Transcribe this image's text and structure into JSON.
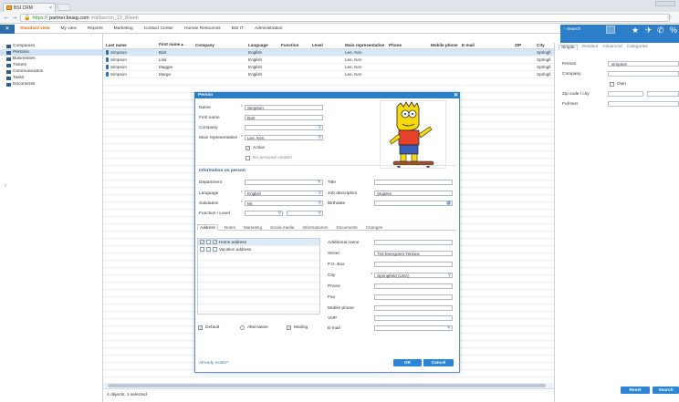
{
  "browser": {
    "tab_title": "BSI CRM",
    "url_scheme": "https://",
    "url_host": "partner.bsiag.com",
    "url_path": "/int/bsicrm_12_8/web"
  },
  "app": {
    "menu": [
      "Standard view",
      "My view",
      "Reports",
      "Marketing",
      "Contact Center",
      "Human Resources",
      "BSI IT",
      "Administration"
    ],
    "active_menu": "Standard view"
  },
  "sidebar": {
    "items": [
      {
        "label": "Companies"
      },
      {
        "label": "Persons"
      },
      {
        "label": "Businesses"
      },
      {
        "label": "Tickets"
      },
      {
        "label": "Communication"
      },
      {
        "label": "Tasks"
      },
      {
        "label": "Documents"
      }
    ]
  },
  "list": {
    "columns": [
      "Last name",
      "First name ▴",
      "Company",
      "Language",
      "Function",
      "Level",
      "Main representative",
      "Phone",
      "Mobile phone",
      "E-mail",
      "ZIP",
      "City"
    ],
    "rows": [
      [
        "Simpson",
        "Bart",
        "",
        "English",
        "",
        "",
        "Lee, Ken",
        "",
        "",
        "",
        "",
        "Springfi"
      ],
      [
        "Simpson",
        "Lisa",
        "",
        "English",
        "",
        "",
        "Lee, Ken",
        "",
        "",
        "",
        "",
        "Springfi"
      ],
      [
        "Simpson",
        "Maggie",
        "",
        "English",
        "",
        "",
        "Lee, Ken",
        "",
        "",
        "",
        "",
        "Springfi"
      ],
      [
        "Simpson",
        "Marge",
        "",
        "English",
        "",
        "",
        "Lee, Ken",
        "",
        "",
        "",
        "",
        "Springfi"
      ]
    ],
    "status": "4 objects, 1 selected"
  },
  "search": {
    "title": "Search",
    "tabs": [
      "Simple",
      "Detailed",
      "Advanced",
      "Categories"
    ],
    "labels": {
      "person": "Person",
      "company": "Company",
      "own": "Own",
      "zip_city": "Zip code / city",
      "fulltext": "Full text"
    },
    "person_value": "simpson",
    "reset_label": "Reset",
    "search_label": "Search"
  },
  "dialog": {
    "title": "Person",
    "fields": {
      "name_label": "Name",
      "name_value": "Simpson",
      "firstname_label": "First name",
      "firstname_value": "Bart",
      "company_label": "Company",
      "company_value": "",
      "mainrep_label": "Main representative",
      "mainrep_value": "Lee, Ken",
      "active_label": "Active",
      "nopersonal_label": "No personal contact"
    },
    "info_section": "Information on person",
    "info": {
      "department_label": "Department",
      "title_label": "Title",
      "language_label": "Language",
      "language_value": "English",
      "jobdesc_label": "Job description",
      "jobdesc_value": "Student",
      "salutation_label": "Salutation",
      "salutation_value": "Mr.",
      "birthdate_label": "Birthdate",
      "function_label": "Function / Level"
    },
    "tabs": [
      "Address",
      "Notes",
      "Marketing",
      "Social media",
      "Informationen",
      "Documents",
      "Changes"
    ],
    "addresses": [
      {
        "label": "Home address"
      },
      {
        "label": "Vacation address"
      }
    ],
    "addr": {
      "addname_label": "Additional name",
      "street_label": "Street",
      "street_value": "742 Evergreen Terrace",
      "pobox_label": "P.O. Box",
      "city_label": "City",
      "city_value": "Springfield (USA)",
      "phone_label": "Phone",
      "fax_label": "Fax",
      "mobile_label": "Mobile phone",
      "voip_label": "VoIP",
      "email_label": "E-mail"
    },
    "checks": {
      "default_label": "Default",
      "alternative_label": "Alternative",
      "mailing_label": "Mailing"
    },
    "exists_link": "Already exists?",
    "ok_label": "OK",
    "cancel_label": "Cancel"
  },
  "colors": {
    "accent": "#2d7ec8",
    "active_menu": "#e66a00",
    "selection": "#d6e7f7"
  }
}
